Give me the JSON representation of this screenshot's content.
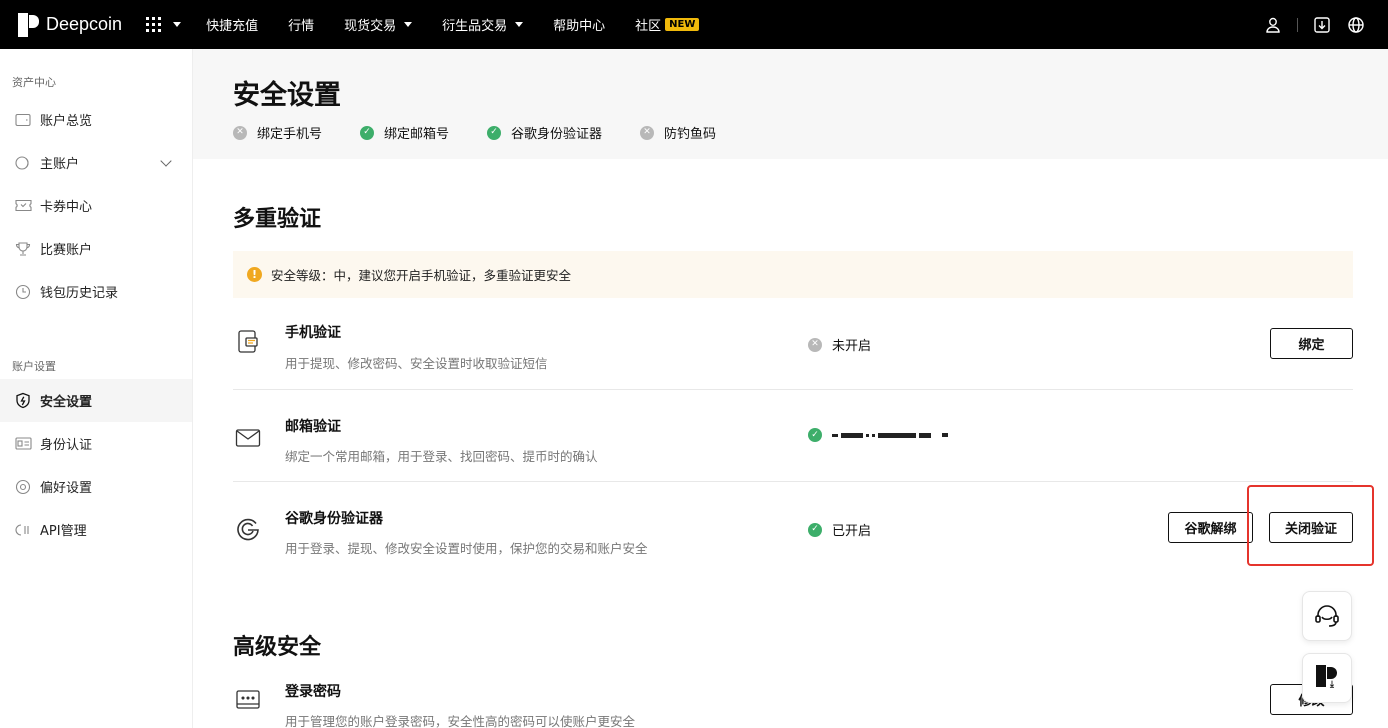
{
  "topbar": {
    "brand": "Deepcoin",
    "nav": [
      {
        "label": "快捷充值",
        "has_menu": false
      },
      {
        "label": "行情",
        "has_menu": false
      },
      {
        "label": "现货交易",
        "has_menu": true
      },
      {
        "label": "衍生品交易",
        "has_menu": true
      },
      {
        "label": "帮助中心",
        "has_menu": false
      },
      {
        "label": "社区",
        "has_menu": false,
        "badge": "NEW"
      }
    ],
    "icons": [
      "user-icon",
      "download-icon",
      "globe-icon"
    ]
  },
  "sidebar": {
    "groups": [
      {
        "title": "资产中心",
        "items": [
          {
            "label": "账户总览",
            "icon": "wallet-icon"
          },
          {
            "label": "主账户",
            "icon": "account-icon",
            "expandable": true
          },
          {
            "label": "卡券中心",
            "icon": "coupon-icon"
          },
          {
            "label": "比赛账户",
            "icon": "trophy-icon"
          },
          {
            "label": "钱包历史记录",
            "icon": "clock-icon"
          }
        ]
      },
      {
        "title": "账户设置",
        "items": [
          {
            "label": "安全设置",
            "icon": "shield-icon",
            "active": true
          },
          {
            "label": "身份认证",
            "icon": "id-card-icon"
          },
          {
            "label": "偏好设置",
            "icon": "settings-icon"
          },
          {
            "label": "API管理",
            "icon": "api-icon"
          }
        ]
      }
    ]
  },
  "page": {
    "title": "安全设置",
    "status_summary": [
      {
        "label": "绑定手机号",
        "done": false
      },
      {
        "label": "绑定邮箱号",
        "done": true
      },
      {
        "label": "谷歌身份验证器",
        "done": true
      },
      {
        "label": "防钓鱼码",
        "done": false
      }
    ]
  },
  "mfa": {
    "title": "多重验证",
    "tip": "安全等级：中，建议您开启手机验证，多重验证更安全",
    "rows": [
      {
        "title": "手机验证",
        "desc": "用于提现、修改密码、安全设置时收取验证短信",
        "status": "未开启",
        "status_ok": false,
        "buttons": [
          "绑定"
        ]
      },
      {
        "title": "邮箱验证",
        "desc": "绑定一个常用邮箱，用于登录、找回密码、提币时的确认",
        "status": "",
        "status_ok": true,
        "buttons": []
      },
      {
        "title": "谷歌身份验证器",
        "desc": "用于登录、提现、修改安全设置时使用，保护您的交易和账户安全",
        "status": "已开启",
        "status_ok": true,
        "buttons": [
          "谷歌解绑",
          "关闭验证"
        ]
      }
    ]
  },
  "advanced": {
    "title": "高级安全",
    "rows": [
      {
        "title": "登录密码",
        "desc": "用于管理您的账户登录密码，安全性高的密码可以使账户更安全",
        "button": "修改"
      }
    ]
  },
  "colors": {
    "topbar_bg": "#000000",
    "success": "#3dae6a",
    "disabled": "#b8b8b8",
    "warning": "#f0a820",
    "tip_bg": "#fdf8ef",
    "highlight": "#e5342c"
  }
}
